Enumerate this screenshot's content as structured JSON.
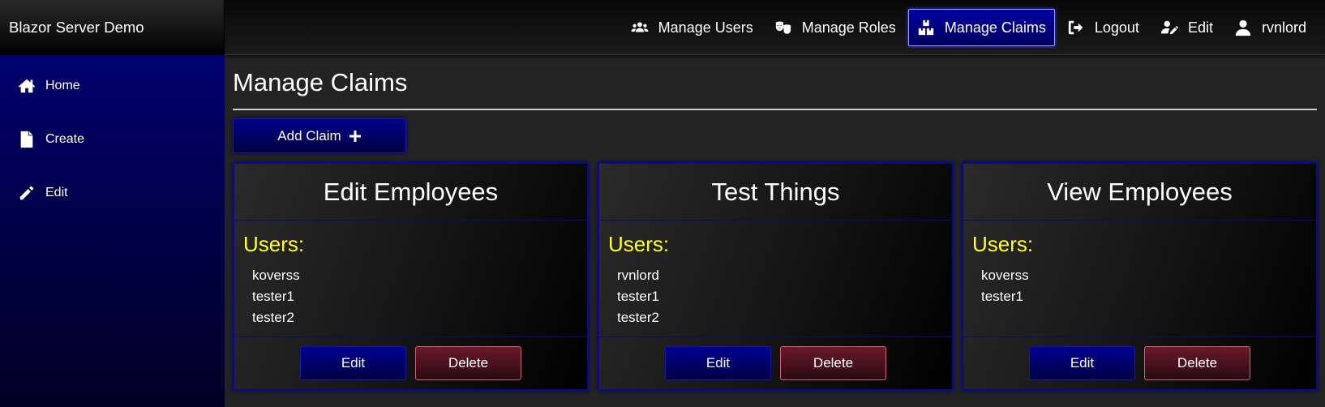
{
  "brand": {
    "title": "Blazor Server Demo"
  },
  "sidebar": {
    "items": [
      {
        "label": "Home",
        "icon": "home-icon"
      },
      {
        "label": "Create",
        "icon": "file-icon"
      },
      {
        "label": "Edit",
        "icon": "pencil-icon"
      }
    ]
  },
  "topnav": {
    "items": [
      {
        "label": "Manage Users",
        "icon": "users-icon"
      },
      {
        "label": "Manage Roles",
        "icon": "masks-icon"
      },
      {
        "label": "Manage Claims",
        "icon": "boxes-icon",
        "active": true
      },
      {
        "label": "Logout",
        "icon": "logout-icon"
      },
      {
        "label": "Edit",
        "icon": "user-edit-icon"
      },
      {
        "label": "rvnlord",
        "icon": "user-icon"
      }
    ]
  },
  "main": {
    "title": "Manage Claims",
    "add_button_label": "Add Claim",
    "users_label": "Users:",
    "edit_label": "Edit",
    "delete_label": "Delete",
    "claims": [
      {
        "name": "Edit Employees",
        "users": [
          "koverss",
          "tester1",
          "tester2"
        ]
      },
      {
        "name": "Test Things",
        "users": [
          "rvnlord",
          "tester1",
          "tester2"
        ]
      },
      {
        "name": "View Employees",
        "users": [
          "koverss",
          "tester1"
        ]
      }
    ]
  },
  "colors": {
    "sidebar_top": "#00006e",
    "accent_blue": "#0000a0",
    "users_label": "#ffff33",
    "delete_border": "#d06070"
  }
}
